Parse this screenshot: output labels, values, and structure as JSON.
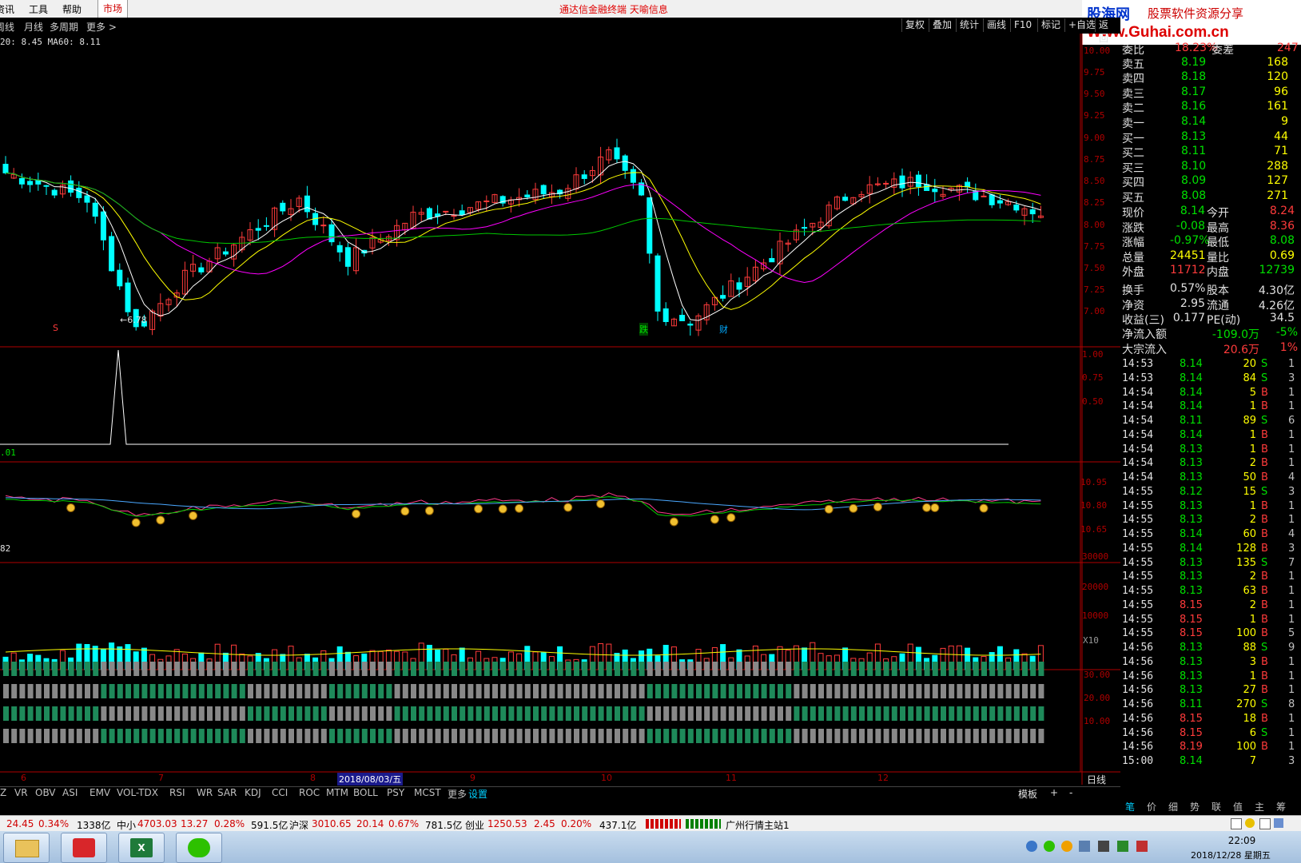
{
  "menu": {
    "items": [
      "资讯",
      "工具",
      "帮助"
    ],
    "market": "市场",
    "title": "通达信金融终端  天喻信息"
  },
  "ad": {
    "site": "股海网",
    "slogan": "股票软件资源分享",
    "url": "Www.Guhai.com.cn"
  },
  "toolbar2": {
    "left": [
      "周线",
      "月线",
      "多周期",
      "更多 >"
    ],
    "right": [
      "复权",
      "叠加",
      "统计",
      "画线",
      "F10",
      "标记",
      "+自选",
      "返回"
    ]
  },
  "legend": {
    "main": "20: 8.45  MA60: 8.11",
    "sub3": ".01",
    "sub4": "82"
  },
  "colors": {
    "up": "#ff3b3b",
    "down": "#00ffff",
    "ma5": "#ffffff",
    "ma10": "#ffff00",
    "ma20": "#ff00ff",
    "ma60": "#00c800",
    "axis": "#b00000"
  },
  "axes": {
    "main": [
      "10.00",
      "9.75",
      "9.50",
      "9.25",
      "9.00",
      "8.75",
      "8.50",
      "8.25",
      "8.00",
      "7.75",
      "7.50",
      "7.25",
      "7.00"
    ],
    "sub1": [
      "1.00",
      "0.75",
      "0.50"
    ],
    "sub2": [
      "10.95",
      "10.80",
      "10.65"
    ],
    "vol": [
      "30000",
      "20000",
      "10000"
    ],
    "vol_unit": "X10",
    "sub4": [
      "30.00",
      "20.00",
      "10.00"
    ]
  },
  "chart_data": {
    "type": "candlestick",
    "period": "日线",
    "ylim": [
      6.6,
      10.2
    ],
    "months": [
      "6",
      "7",
      "8",
      "9",
      "10",
      "11",
      "12"
    ],
    "crosshair_date": "2018/08/03/五",
    "low_marker": "←6.78",
    "event_marks": [
      {
        "label": "S",
        "color": "#ff3b3b"
      },
      {
        "label": "跌",
        "color": "#00e000"
      },
      {
        "label": "财",
        "color": "#00aaff"
      }
    ],
    "key_prices": {
      "start": 8.6,
      "low": 6.78,
      "high": 8.8,
      "last": 8.14
    }
  },
  "quote": {
    "weibi": {
      "label": "委比",
      "val": "18.23%",
      "label2": "委差",
      "val2": "247"
    },
    "asks": [
      {
        "label": "卖五",
        "price": "8.19",
        "vol": "168"
      },
      {
        "label": "卖四",
        "price": "8.18",
        "vol": "120"
      },
      {
        "label": "卖三",
        "price": "8.17",
        "vol": "96"
      },
      {
        "label": "卖二",
        "price": "8.16",
        "vol": "161"
      },
      {
        "label": "卖一",
        "price": "8.14",
        "vol": "9"
      }
    ],
    "bids": [
      {
        "label": "买一",
        "price": "8.13",
        "vol": "44"
      },
      {
        "label": "买二",
        "price": "8.11",
        "vol": "71"
      },
      {
        "label": "买三",
        "price": "8.10",
        "vol": "288"
      },
      {
        "label": "买四",
        "price": "8.09",
        "vol": "127"
      },
      {
        "label": "买五",
        "price": "8.08",
        "vol": "271"
      }
    ],
    "stats": [
      {
        "l1": "现价",
        "v1": "8.14",
        "c1": "green",
        "l2": "今开",
        "v2": "8.24",
        "c2": "red"
      },
      {
        "l1": "涨跌",
        "v1": "-0.08",
        "c1": "green",
        "l2": "最高",
        "v2": "8.36",
        "c2": "red"
      },
      {
        "l1": "涨幅",
        "v1": "-0.97%",
        "c1": "green",
        "l2": "最低",
        "v2": "8.08",
        "c2": "green"
      },
      {
        "l1": "总量",
        "v1": "24451",
        "c1": "yellow",
        "l2": "量比",
        "v2": "0.69",
        "c2": "yellow"
      },
      {
        "l1": "外盘",
        "v1": "11712",
        "c1": "red",
        "l2": "内盘",
        "v2": "12739",
        "c2": "green"
      },
      {
        "l1": "换手",
        "v1": "0.57%",
        "c1": "white",
        "l2": "股本",
        "v2": "4.30亿",
        "c2": "white"
      },
      {
        "l1": "净资",
        "v1": "2.95",
        "c1": "white",
        "l2": "流通",
        "v2": "4.26亿",
        "c2": "white"
      },
      {
        "l1": "收益(三)",
        "v1": "0.177",
        "c1": "white",
        "l2": "PE(动)",
        "v2": "34.5",
        "c2": "white"
      }
    ],
    "flow": [
      {
        "label": "净流入额",
        "val": "-109.0万",
        "pct": "-5%",
        "c": "green"
      },
      {
        "label": "大宗流入",
        "val": "20.6万",
        "pct": "1%",
        "c": "red"
      }
    ]
  },
  "ticks": [
    [
      "14:53",
      "8.14",
      "20",
      "S",
      "1"
    ],
    [
      "14:53",
      "8.14",
      "84",
      "S",
      "3"
    ],
    [
      "14:54",
      "8.14",
      "5",
      "B",
      "1"
    ],
    [
      "14:54",
      "8.14",
      "1",
      "B",
      "1"
    ],
    [
      "14:54",
      "8.11",
      "89",
      "S",
      "6"
    ],
    [
      "14:54",
      "8.14",
      "1",
      "B",
      "1"
    ],
    [
      "14:54",
      "8.13",
      "1",
      "B",
      "1"
    ],
    [
      "14:54",
      "8.13",
      "2",
      "B",
      "1"
    ],
    [
      "14:54",
      "8.13",
      "50",
      "B",
      "4"
    ],
    [
      "14:55",
      "8.12",
      "15",
      "S",
      "3"
    ],
    [
      "14:55",
      "8.13",
      "1",
      "B",
      "1"
    ],
    [
      "14:55",
      "8.13",
      "2",
      "B",
      "1"
    ],
    [
      "14:55",
      "8.14",
      "60",
      "B",
      "4"
    ],
    [
      "14:55",
      "8.14",
      "128",
      "B",
      "3"
    ],
    [
      "14:55",
      "8.13",
      "135",
      "S",
      "7"
    ],
    [
      "14:55",
      "8.13",
      "2",
      "B",
      "1"
    ],
    [
      "14:55",
      "8.13",
      "63",
      "B",
      "1"
    ],
    [
      "14:55",
      "8.15",
      "2",
      "B",
      "1"
    ],
    [
      "14:55",
      "8.15",
      "1",
      "B",
      "1"
    ],
    [
      "14:55",
      "8.15",
      "100",
      "B",
      "5"
    ],
    [
      "14:56",
      "8.13",
      "88",
      "S",
      "9"
    ],
    [
      "14:56",
      "8.13",
      "3",
      "B",
      "1"
    ],
    [
      "14:56",
      "8.13",
      "1",
      "B",
      "1"
    ],
    [
      "14:56",
      "8.13",
      "27",
      "B",
      "1"
    ],
    [
      "14:56",
      "8.11",
      "270",
      "S",
      "8"
    ],
    [
      "14:56",
      "8.15",
      "18",
      "B",
      "1"
    ],
    [
      "14:56",
      "8.15",
      "6",
      "S",
      "1"
    ],
    [
      "14:56",
      "8.19",
      "100",
      "B",
      "1"
    ],
    [
      "15:00",
      "8.14",
      "7",
      "",
      "3"
    ]
  ],
  "indicator_tabs": [
    "Z",
    "VR",
    "OBV",
    "ASI",
    "EMV",
    "VOL-TDX",
    "RSI",
    "WR",
    "SAR",
    "KDJ",
    "CCI",
    "ROC",
    "MTM",
    "BOLL",
    "PSY",
    "MCST",
    "更多",
    "设置"
  ],
  "bottom_right": {
    "template": "模板",
    "plus": "+",
    "minus": "-"
  },
  "panel_tabs": [
    "笔",
    "价",
    "细",
    "势",
    "联",
    "值",
    "主",
    "筹"
  ],
  "status": {
    "sh": "24.45",
    "sh_pct": "0.34%",
    "sh_amt": "1338亿",
    "zx_label": "中小",
    "zx": "4703.03",
    "zx_chg": "13.27",
    "zx_pct": "0.28%",
    "zx_amt": "591.5亿",
    "hs_label": "沪深",
    "hs": "3010.65",
    "hs_chg": "20.14",
    "hs_pct": "0.67%",
    "hs_amt": "781.5亿",
    "cy_label": "创业",
    "cy": "1250.53",
    "cy_chg": "2.45",
    "cy_pct": "0.20%",
    "cy_amt": "437.1亿",
    "server": "广州行情主站1"
  },
  "taskbar": {
    "time": "22:09",
    "date": "2018/12/28 星期五"
  }
}
